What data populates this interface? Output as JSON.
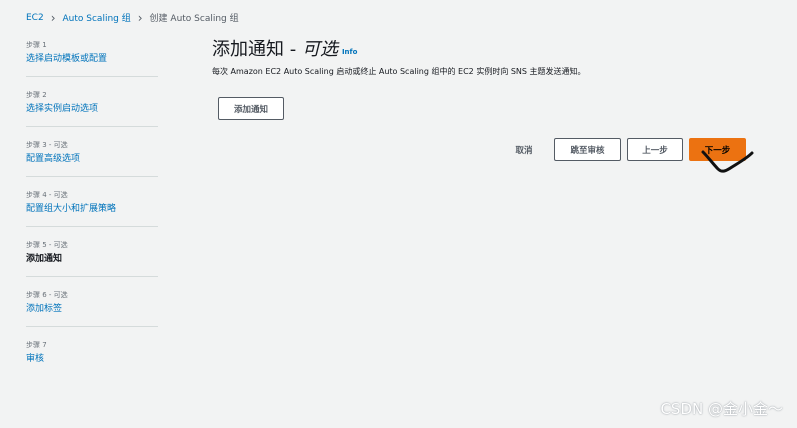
{
  "breadcrumb": {
    "items": [
      "EC2",
      "Auto Scaling 组"
    ],
    "current": "创建 Auto Scaling 组",
    "separator": "›"
  },
  "steps": [
    {
      "label": "步骤 1",
      "title": "选择启动模板或配置"
    },
    {
      "label": "步骤 2",
      "title": "选择实例启动选项"
    },
    {
      "label": "步骤 3 - 可选",
      "title": "配置高级选项"
    },
    {
      "label": "步骤 4 - 可选",
      "title": "配置组大小和扩展策略"
    },
    {
      "label": "步骤 5 - 可选",
      "title": "添加通知"
    },
    {
      "label": "步骤 6 - 可选",
      "title": "添加标签"
    },
    {
      "label": "步骤 7",
      "title": "审核"
    }
  ],
  "main": {
    "title": "添加通知 - ",
    "title_optional": "可选",
    "info": "Info",
    "description": "每次 Amazon EC2 Auto Scaling 启动或终止 Auto Scaling 组中的 EC2 实例时向 SNS 主题发送通知。",
    "add_button": "添加通知"
  },
  "footer": {
    "cancel": "取消",
    "skip": "跳至审核",
    "previous": "上一步",
    "next": "下一步"
  },
  "watermark": "CSDN @金小金～",
  "colors": {
    "link": "#0073bb",
    "primary": "#ec7211",
    "background": "#f2f3f3"
  }
}
